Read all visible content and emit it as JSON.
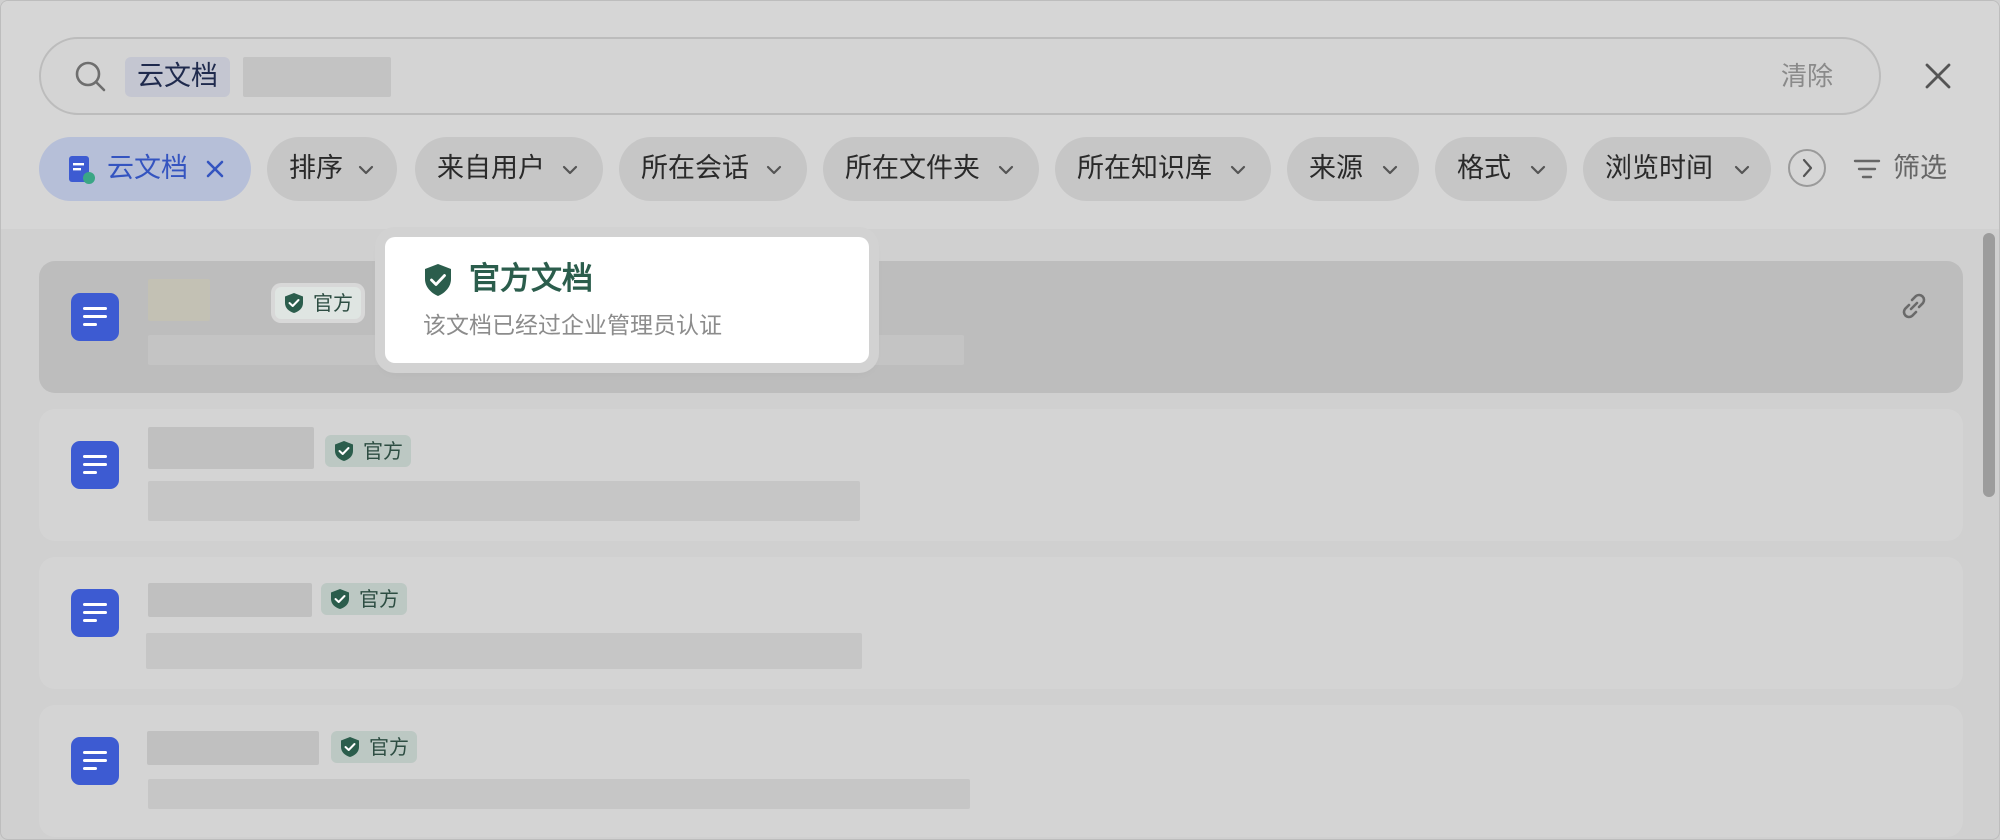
{
  "search": {
    "token": "云文档",
    "clear_label": "清除"
  },
  "filters": {
    "active_chip": "云文档",
    "chips": [
      "排序",
      "来自用户",
      "所在会话",
      "所在文件夹",
      "所在知识库",
      "来源",
      "格式",
      "浏览时间"
    ],
    "filter_label": "筛选"
  },
  "results": {
    "badge_label": "官方"
  },
  "tooltip": {
    "title": "官方文档",
    "description": "该文档已经过企业管理员认证"
  },
  "colors": {
    "doc_icon": "#3d5bd2",
    "official_green": "#2b5d4c",
    "active_chip_text": "#3454c0"
  },
  "icons": {
    "search": "search-icon",
    "close": "close-icon",
    "chevron": "chevron-down-icon",
    "more": "chevron-right-icon",
    "filter": "filter-icon",
    "doc": "doc-icon",
    "shield": "shield-check-icon",
    "link": "link-icon"
  }
}
